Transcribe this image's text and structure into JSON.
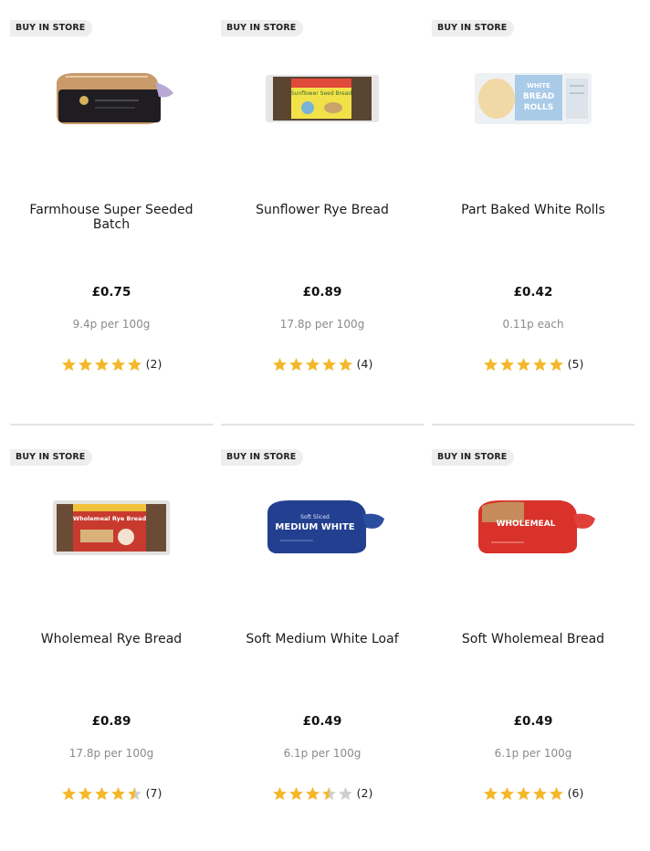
{
  "colors": {
    "star_filled": "#f5b72a",
    "star_empty": "#cfcfcf",
    "badge_bg": "#eeeeee",
    "separator": "#e3e3e3"
  },
  "products": [
    {
      "badge": "BUY IN STORE",
      "name": "Farmhouse Super Seeded Batch",
      "price": "£0.75",
      "unit_price": "9.4p per 100g",
      "rating": 5,
      "rating_count": "(2)",
      "image": "seeded-batch-loaf"
    },
    {
      "badge": "BUY IN STORE",
      "name": "Sunflower Rye Bread",
      "price": "£0.89",
      "unit_price": "17.8p per 100g",
      "rating": 5,
      "rating_count": "(4)",
      "image": "sunflower-rye-pack"
    },
    {
      "badge": "BUY IN STORE",
      "name": "Part Baked White Rolls",
      "price": "£0.42",
      "unit_price": "0.11p each",
      "rating": 5,
      "rating_count": "(5)",
      "image": "white-rolls-pack"
    },
    {
      "badge": "BUY IN STORE",
      "name": "Wholemeal Rye Bread",
      "price": "£0.89",
      "unit_price": "17.8p per 100g",
      "rating": 4.5,
      "rating_count": "(7)",
      "image": "wholemeal-rye-pack"
    },
    {
      "badge": "BUY IN STORE",
      "name": "Soft Medium White Loaf",
      "price": "£0.49",
      "unit_price": "6.1p per 100g",
      "rating": 3.5,
      "rating_count": "(2)",
      "image": "medium-white-loaf"
    },
    {
      "badge": "BUY IN STORE",
      "name": "Soft Wholemeal Bread",
      "price": "£0.49",
      "unit_price": "6.1p per 100g",
      "rating": 5,
      "rating_count": "(6)",
      "image": "wholemeal-loaf"
    }
  ],
  "image_text": {
    "sunflower_label": "Sunflower Seed Bread",
    "rolls_line1": "WHITE",
    "rolls_line2": "BREAD",
    "rolls_line3": "ROLLS",
    "rye_label": "Wholemeal Rye Bread",
    "medium_small": "Soft Sliced",
    "medium_big": "MEDIUM WHITE",
    "wholemeal_big": "WHOLEMEAL"
  }
}
